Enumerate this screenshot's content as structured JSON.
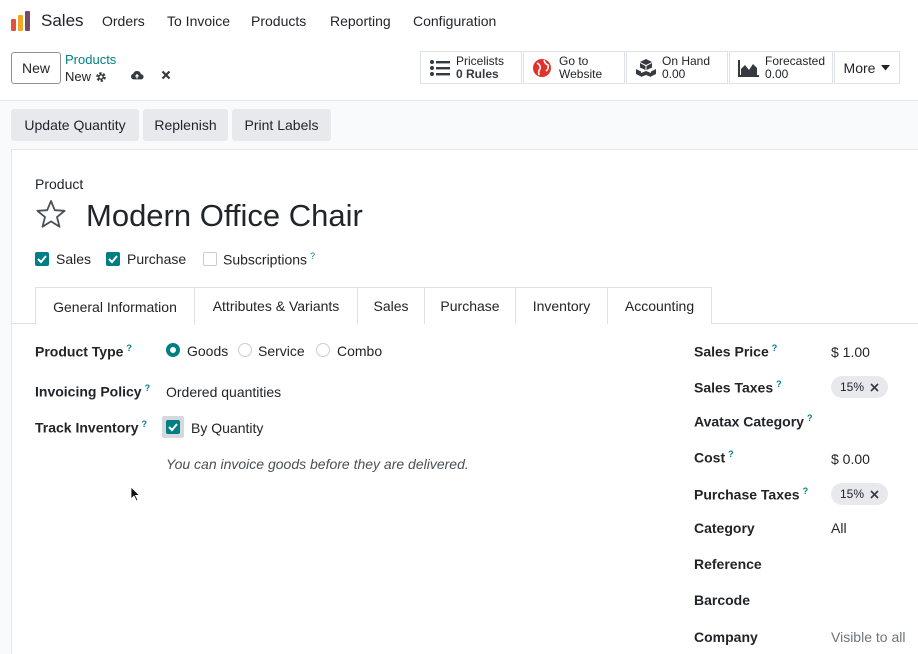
{
  "app": {
    "name": "Sales",
    "brand_color": "#714B67",
    "accent_color": "#017e84"
  },
  "menu": [
    "Orders",
    "To Invoice",
    "Products",
    "Reporting",
    "Configuration"
  ],
  "control": {
    "new_label": "New",
    "breadcrumb_parent": "Products",
    "breadcrumb_current": "New",
    "stats": [
      {
        "icon": "list-icon",
        "line1": "Pricelists",
        "line2": "0 Rules"
      },
      {
        "icon": "globe-icon",
        "line1": "Go to",
        "line2": "Website"
      },
      {
        "icon": "cubes-icon",
        "line1": "On Hand",
        "line2": "0.00"
      },
      {
        "icon": "area-chart-icon",
        "line1": "Forecasted",
        "line2": "0.00"
      }
    ],
    "more_label": "More"
  },
  "actions": [
    "Update Quantity",
    "Replenish",
    "Print Labels"
  ],
  "form": {
    "product_label": "Product",
    "product_name": "Modern Office Chair",
    "checks": [
      {
        "label": "Sales",
        "checked": true
      },
      {
        "label": "Purchase",
        "checked": true
      },
      {
        "label": "Subscriptions",
        "checked": false,
        "help": "?"
      }
    ],
    "tabs": [
      "General Information",
      "Attributes & Variants",
      "Sales",
      "Purchase",
      "Inventory",
      "Accounting"
    ],
    "left": {
      "product_type_label": "Product Type",
      "product_type_options": [
        "Goods",
        "Service",
        "Combo"
      ],
      "product_type_selected": "Goods",
      "invoicing_policy_label": "Invoicing Policy",
      "invoicing_policy_value": "Ordered quantities",
      "track_inventory_label": "Track Inventory",
      "track_inventory_value": "By Quantity",
      "hint": "You can invoice goods before they are delivered."
    },
    "right": {
      "sales_price_label": "Sales Price",
      "sales_price_value": "$ 1.00",
      "sales_taxes_label": "Sales Taxes",
      "sales_taxes_tag": "15%",
      "avatax_label": "Avatax Category",
      "cost_label": "Cost",
      "cost_value": "$ 0.00",
      "purchase_taxes_label": "Purchase Taxes",
      "purchase_taxes_tag": "15%",
      "category_label": "Category",
      "category_value": "All",
      "reference_label": "Reference",
      "barcode_label": "Barcode",
      "company_label": "Company",
      "company_placeholder": "Visible to all"
    },
    "help_mark": "?"
  }
}
